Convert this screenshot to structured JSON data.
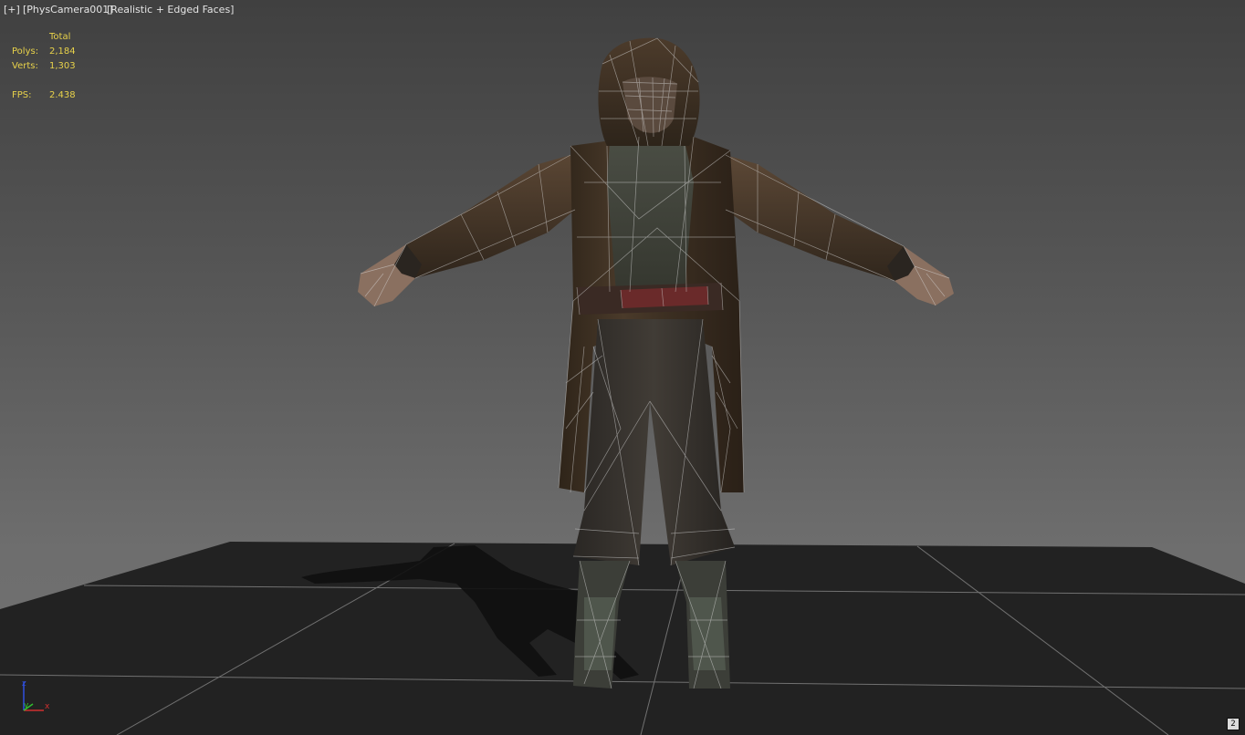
{
  "viewport": {
    "menu": {
      "plus": "[+]",
      "camera": "[PhysCamera001]",
      "shading": "[Realistic + Edged Faces]"
    },
    "stats": {
      "header": "Total",
      "polys_label": "Polys:",
      "polys_value": "2,184",
      "verts_label": "Verts:",
      "verts_value": "1,303",
      "fps_label": "FPS:",
      "fps_value": "2.438"
    },
    "axis_gizmo": {
      "z": "z",
      "y": "y",
      "x": "x"
    },
    "badge": "2"
  },
  "colors": {
    "stats_text": "#e8d24a",
    "menu_text": "#e4e4e4",
    "wireframe": "#d8d8d8",
    "ground": "#222222",
    "axis_x": "#d03030",
    "axis_y": "#30c030",
    "axis_z": "#3050e0"
  }
}
